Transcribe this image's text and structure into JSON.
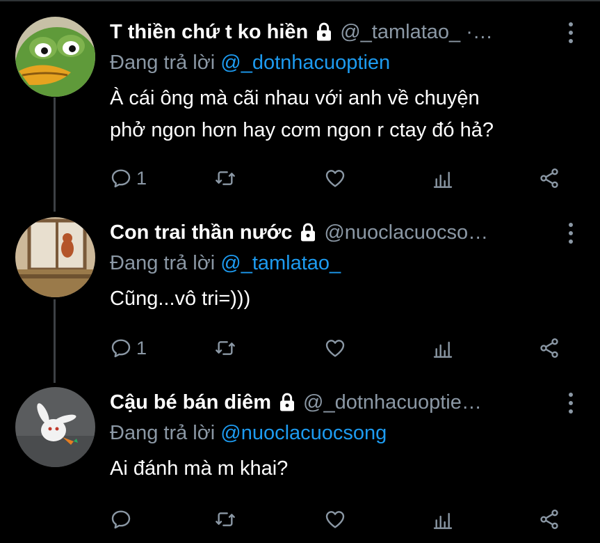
{
  "tweets": [
    {
      "display_name": "T thiền chứ t ko hiền",
      "handle": "@_tamlatao_ ·…",
      "replying_prefix": "Đang trả lời",
      "replying_to": "@_dotnhacuoptien",
      "text_lines": [
        "À cái ông mà cãi nhau với anh về chuyện",
        "phở ngon hơn hay cơm ngon r ctay đó hả?"
      ],
      "reply_count": "1",
      "avatar": "pepe-frog-avatar"
    },
    {
      "display_name": "Con trai thần nước",
      "handle": "@nuoclacuocso…",
      "replying_prefix": "Đang trả lời",
      "replying_to": "@_tamlatao_",
      "text_lines": [
        "Cũng...vô tri=)))"
      ],
      "reply_count": "1",
      "avatar": "cartoon-window-avatar"
    },
    {
      "display_name": "Cậu bé bán diêm",
      "handle": "@_dotnhacuoptie…",
      "replying_prefix": "Đang trả lời",
      "replying_to": "@nuoclacuocsong",
      "text_lines": [
        "Ai đánh mà m khai?"
      ],
      "reply_count": "",
      "avatar": "white-bunny-avatar"
    }
  ],
  "colors": {
    "background": "#000000",
    "secondary_text": "#8b98a5",
    "mention": "#1d9bf0",
    "thread_line": "#3d4145"
  },
  "icons": [
    "lock-icon",
    "more-icon",
    "reply-icon",
    "retweet-icon",
    "like-icon",
    "analytics-icon",
    "share-icon"
  ]
}
